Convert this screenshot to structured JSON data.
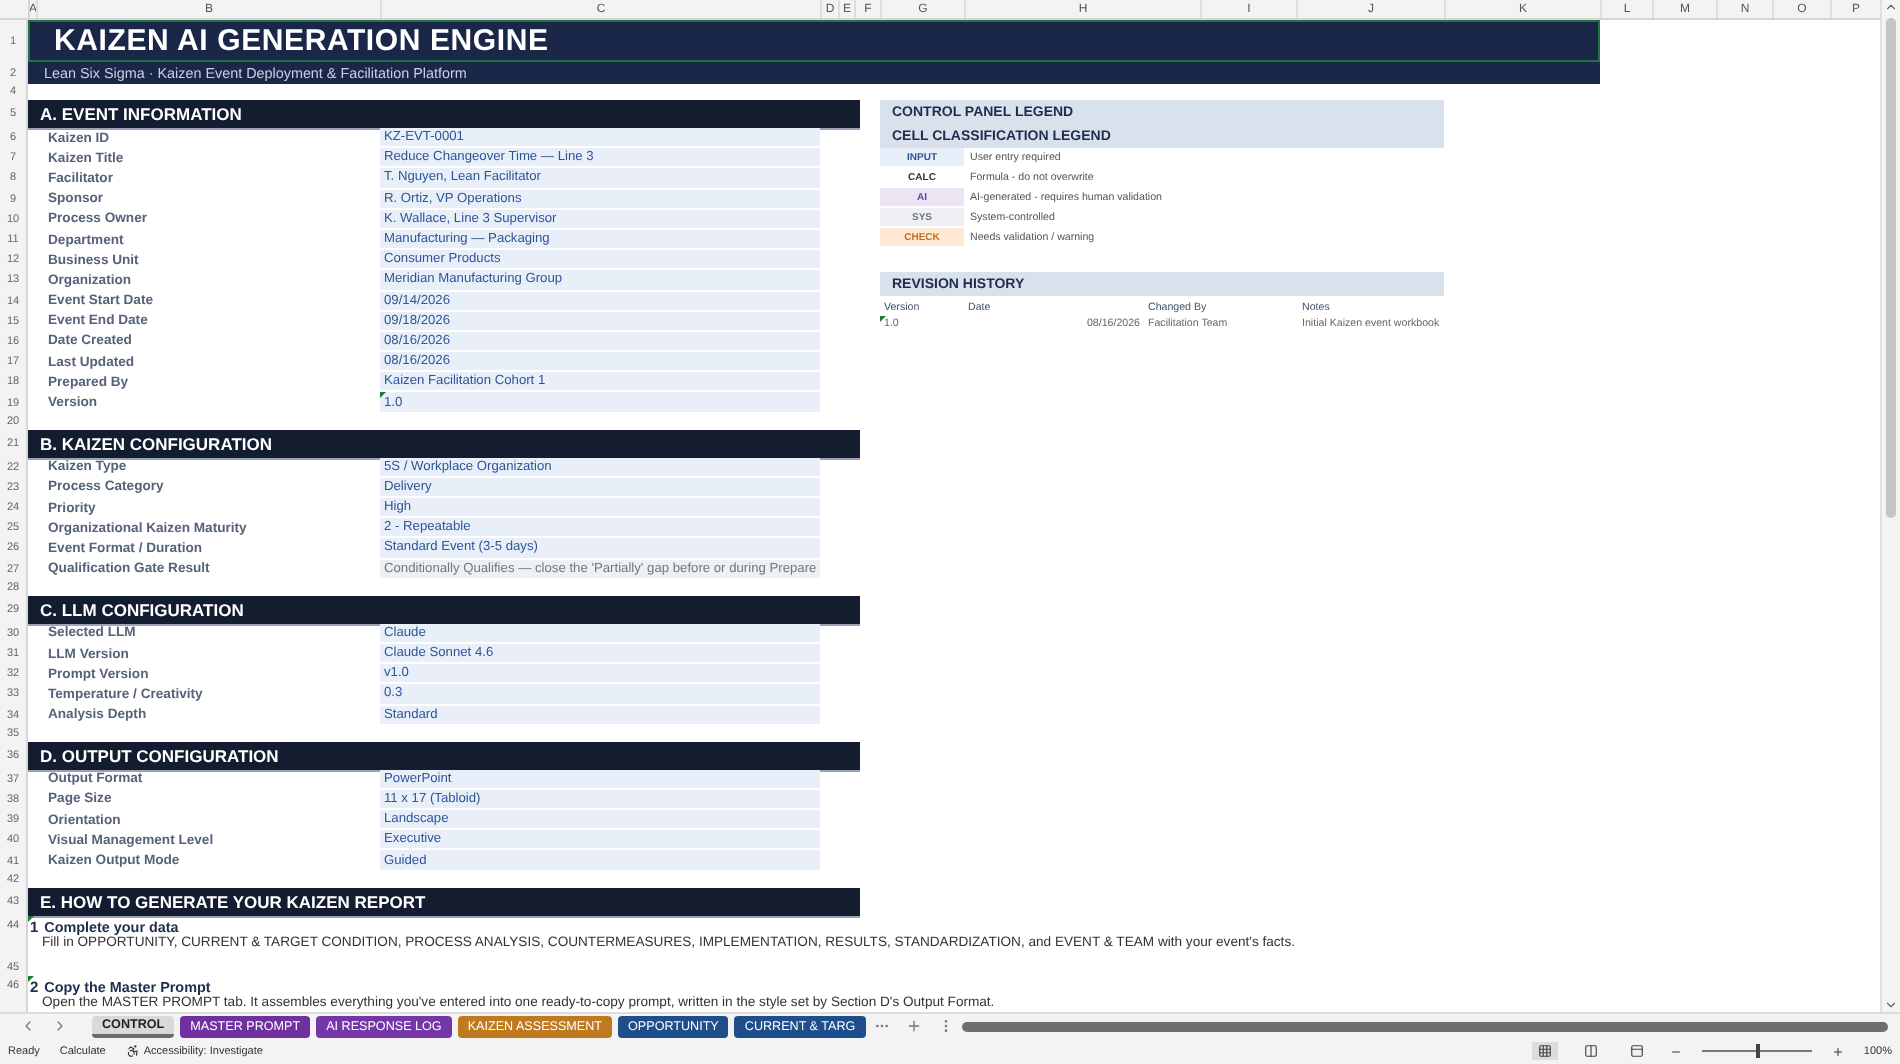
{
  "columns": [
    "A",
    "B",
    "C",
    "D",
    "E",
    "F",
    "G",
    "H",
    "I",
    "J",
    "K",
    "L",
    "M",
    "N",
    "O",
    "P"
  ],
  "header": {
    "title_row": "1",
    "subtitle_row": "2",
    "title": "KAIZEN AI GENERATION ENGINE",
    "subtitle": "Lean Six Sigma · Kaizen Event Deployment & Facilitation Platform",
    "selected": true
  },
  "rows": [
    {
      "kind": "spacer",
      "row": "4"
    },
    {
      "kind": "section",
      "row": "5",
      "title": "A.  EVENT INFORMATION"
    },
    {
      "kind": "field",
      "row": "6",
      "label": "Kaizen ID",
      "value": "KZ-EVT-0001",
      "locked": false,
      "flagged": false
    },
    {
      "kind": "field",
      "row": "7",
      "label": "Kaizen Title",
      "value": "Reduce Changeover Time — Line 3",
      "locked": false,
      "flagged": false
    },
    {
      "kind": "field",
      "row": "8",
      "label": "Facilitator",
      "value": "T. Nguyen, Lean Facilitator",
      "locked": false,
      "flagged": false
    },
    {
      "kind": "field",
      "row": "9",
      "label": "Sponsor",
      "value": "R. Ortiz, VP Operations",
      "locked": false,
      "flagged": false
    },
    {
      "kind": "field",
      "row": "10",
      "label": "Process Owner",
      "value": "K. Wallace, Line 3 Supervisor",
      "locked": false,
      "flagged": false
    },
    {
      "kind": "field",
      "row": "11",
      "label": "Department",
      "value": "Manufacturing — Packaging",
      "locked": false,
      "flagged": false
    },
    {
      "kind": "field",
      "row": "12",
      "label": "Business Unit",
      "value": "Consumer Products",
      "locked": false,
      "flagged": false
    },
    {
      "kind": "field",
      "row": "13",
      "label": "Organization",
      "value": "Meridian Manufacturing Group",
      "locked": false,
      "flagged": false
    },
    {
      "kind": "field",
      "row": "14",
      "label": "Event Start Date",
      "value": "09/14/2026",
      "locked": false,
      "flagged": false
    },
    {
      "kind": "field",
      "row": "15",
      "label": "Event End Date",
      "value": "09/18/2026",
      "locked": false,
      "flagged": false
    },
    {
      "kind": "field",
      "row": "16",
      "label": "Date Created",
      "value": "08/16/2026",
      "locked": false,
      "flagged": false
    },
    {
      "kind": "field",
      "row": "17",
      "label": "Last Updated",
      "value": "08/16/2026",
      "locked": false,
      "flagged": false
    },
    {
      "kind": "field",
      "row": "18",
      "label": "Prepared By",
      "value": "Kaizen Facilitation Cohort 1",
      "locked": false,
      "flagged": false
    },
    {
      "kind": "field",
      "row": "19",
      "label": "Version",
      "value": "1.0",
      "locked": false,
      "flagged": true
    },
    {
      "kind": "spacer",
      "row": "20"
    },
    {
      "kind": "section",
      "row": "21",
      "title": "B.  KAIZEN CONFIGURATION"
    },
    {
      "kind": "field",
      "row": "22",
      "label": "Kaizen Type",
      "value": "5S / Workplace Organization",
      "locked": false,
      "flagged": false
    },
    {
      "kind": "field",
      "row": "23",
      "label": "Process Category",
      "value": "Delivery",
      "locked": false,
      "flagged": false
    },
    {
      "kind": "field",
      "row": "24",
      "label": "Priority",
      "value": "High",
      "locked": false,
      "flagged": false
    },
    {
      "kind": "field",
      "row": "25",
      "label": "Organizational Kaizen Maturity",
      "value": "2 - Repeatable",
      "locked": false,
      "flagged": false
    },
    {
      "kind": "field",
      "row": "26",
      "label": "Event Format / Duration",
      "value": "Standard Event (3-5 days)",
      "locked": false,
      "flagged": false
    },
    {
      "kind": "field",
      "row": "27",
      "label": "Qualification Gate Result",
      "value": "Conditionally Qualifies — close the 'Partially' gap before or during Prepare",
      "locked": true,
      "flagged": false
    },
    {
      "kind": "spacer",
      "row": "28"
    },
    {
      "kind": "section",
      "row": "29",
      "title": "C.  LLM CONFIGURATION"
    },
    {
      "kind": "field",
      "row": "30",
      "label": "Selected LLM",
      "value": "Claude",
      "locked": false,
      "flagged": false
    },
    {
      "kind": "field",
      "row": "31",
      "label": "LLM Version",
      "value": "Claude Sonnet 4.6",
      "locked": false,
      "flagged": false
    },
    {
      "kind": "field",
      "row": "32",
      "label": "Prompt Version",
      "value": "v1.0",
      "locked": false,
      "flagged": false
    },
    {
      "kind": "field",
      "row": "33",
      "label": "Temperature / Creativity",
      "value": "0.3",
      "locked": false,
      "flagged": false
    },
    {
      "kind": "field",
      "row": "34",
      "label": "Analysis Depth",
      "value": "Standard",
      "locked": false,
      "flagged": false
    },
    {
      "kind": "spacer",
      "row": "35"
    },
    {
      "kind": "section",
      "row": "36",
      "title": "D.  OUTPUT CONFIGURATION"
    },
    {
      "kind": "field",
      "row": "37",
      "label": "Output Format",
      "value": "PowerPoint",
      "locked": false,
      "flagged": false
    },
    {
      "kind": "field",
      "row": "38",
      "label": "Page Size",
      "value": "11 x 17 (Tabloid)",
      "locked": false,
      "flagged": false
    },
    {
      "kind": "field",
      "row": "39",
      "label": "Orientation",
      "value": "Landscape",
      "locked": false,
      "flagged": false
    },
    {
      "kind": "field",
      "row": "40",
      "label": "Visual Management Level",
      "value": "Executive",
      "locked": false,
      "flagged": false
    },
    {
      "kind": "field",
      "row": "41",
      "label": "Kaizen Output Mode",
      "value": "Guided",
      "locked": false,
      "flagged": false
    },
    {
      "kind": "spacer",
      "row": "42"
    }
  ],
  "guide_rows": [
    {
      "kind": "section",
      "row": "43",
      "title": "E.  HOW TO GENERATE YOUR KAIZEN REPORT"
    },
    {
      "kind": "step",
      "row": "44",
      "number": "1",
      "title": "Complete your data",
      "text": "Fill in OPPORTUNITY, CURRENT & TARGET CONDITION, PROCESS ANALYSIS, COUNTERMEASURES, IMPLEMENTATION, RESULTS, STANDARDIZATION, and EVENT & TEAM with your event's facts.",
      "flagged": true
    },
    {
      "kind": "spacer",
      "row": "45"
    },
    {
      "kind": "step",
      "row": "46",
      "number": "2",
      "title": "Copy the Master Prompt",
      "text": "Open the MASTER PROMPT tab. It assembles everything you've entered into one ready-to-copy prompt, written in the style set by Section D's Output Format.",
      "flagged": true
    }
  ],
  "legend": {
    "title": "CONTROL PANEL LEGEND",
    "subtitle": "CELL CLASSIFICATION LEGEND",
    "items": [
      {
        "tag": "INPUT",
        "text": "User entry required",
        "color": "#e8eff9"
      },
      {
        "tag": "CALC",
        "text": "Formula - do not overwrite",
        "color": "#ffffff"
      },
      {
        "tag": "AI",
        "text": "AI-generated - requires human validation",
        "color": "#ece4f5"
      },
      {
        "tag": "SYS",
        "text": "System-controlled",
        "color": "#eef0f3"
      },
      {
        "tag": "CHECK",
        "text": "Needs validation / warning",
        "color": "#fde9d4"
      }
    ]
  },
  "revision_history": {
    "title": "REVISION HISTORY",
    "columns": [
      "Version",
      "Date",
      "Changed By",
      "Notes"
    ],
    "rows": [
      {
        "cells": [
          "1.0",
          "08/16/2026",
          "Facilitation Team",
          "Initial Kaizen event workbook"
        ],
        "flagged": true
      }
    ]
  },
  "sheet_tabs": [
    {
      "label": "CONTROL",
      "selected": true,
      "color": "#d9d9d9"
    },
    {
      "label": "MASTER PROMPT",
      "selected": false,
      "color": "#7030a0"
    },
    {
      "label": "AI RESPONSE LOG",
      "selected": false,
      "color": "#7436a8"
    },
    {
      "label": "KAIZEN ASSESSMENT",
      "selected": false,
      "color": "#bf7a1f"
    },
    {
      "label": "OPPORTUNITY",
      "selected": false,
      "color": "#1f4e8c"
    },
    {
      "label": "CURRENT & TARG",
      "selected": false,
      "color": "#1f4e8c"
    }
  ],
  "status_bar": {
    "items": [
      "Ready",
      "Calculate"
    ],
    "accessibility": "Accessibility: Investigate",
    "zoom": "100%",
    "zoom_slider": {
      "level": 0.5
    }
  }
}
